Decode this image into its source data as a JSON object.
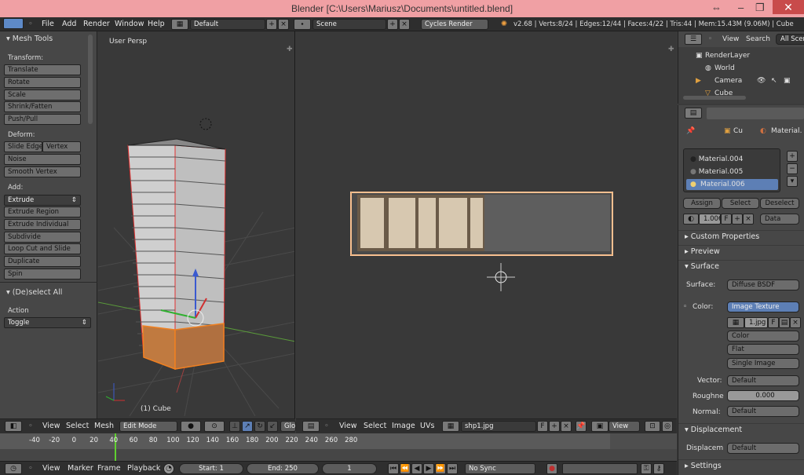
{
  "window": {
    "title": "Blender [C:\\Users\\Mariusz\\Documents\\untitled.blend]",
    "controls": [
      "⇔",
      "–",
      "❐",
      "✕"
    ]
  },
  "info_header": {
    "menus": [
      "File",
      "Add",
      "Render",
      "Window",
      "Help"
    ],
    "screen_layout": "Default",
    "scene": "Scene",
    "render_engine": "Cycles Render",
    "stats": "v2.68 | Verts:8/24 | Edges:12/44 | Faces:4/22 | Tris:44 | Mem:15.43M (9.06M) | Cube"
  },
  "tool_shelf": {
    "title": "Mesh Tools",
    "transform_label": "Transform:",
    "transform": [
      "Translate",
      "Rotate",
      "Scale",
      "Shrink/Fatten",
      "Push/Pull"
    ],
    "deform_label": "Deform:",
    "deform_row": [
      "Slide Edge",
      "Vertex"
    ],
    "deform": [
      "Noise",
      "Smooth Vertex"
    ],
    "add_label": "Add:",
    "add_dropdown": "Extrude",
    "add": [
      "Extrude Region",
      "Extrude Individual",
      "Subdivide",
      "Loop Cut and Slide",
      "Duplicate",
      "Spin"
    ],
    "operator_title": "(De)select All",
    "action_label": "Action",
    "action_value": "Toggle"
  },
  "viewport3d": {
    "view_name": "User Persp",
    "object_label": "(1) Cube"
  },
  "view3d_header": {
    "menus": [
      "View",
      "Select",
      "Mesh"
    ],
    "mode": "Edit Mode",
    "more": "Glo"
  },
  "uv_header": {
    "menus": [
      "View",
      "Select",
      "Image",
      "UVs"
    ],
    "image": "shp1.jpg",
    "fake_user": "F",
    "view_dropdown": "View"
  },
  "outliner": {
    "menus": [
      "View",
      "Search"
    ],
    "filter": "All Scen",
    "items": [
      "RenderLayer",
      "World",
      "Camera",
      "Cube"
    ]
  },
  "properties": {
    "breadcrumb": [
      "Cu",
      "Material."
    ],
    "materials": [
      "Material.004",
      "Material.005",
      "Material.006"
    ],
    "selected_material": 2,
    "assign_buttons": [
      "Assign",
      "Select",
      "Deselect"
    ],
    "slot_value": "1.006",
    "slot_f": "F",
    "data_dropdown": "Data",
    "panels": {
      "custom": "Custom Properties",
      "preview": "Preview",
      "surface": "Surface",
      "displacement": "Displacement",
      "settings": "Settings"
    },
    "surface_label": "Surface:",
    "surface_value": "Diffuse BSDF",
    "color_label": "Color:",
    "color_value": "Image Texture",
    "image_name": "1.jpg",
    "image_f": "F",
    "color_space": "Color",
    "projection": "Flat",
    "source": "Single Image",
    "vector_label": "Vector:",
    "vector_value": "Default",
    "roughness_label": "Roughne",
    "roughness_value": "0.000",
    "normal_label": "Normal:",
    "normal_value": "Default",
    "displacement_label": "Displacem",
    "displacement_value": "Default"
  },
  "timeline": {
    "ticks": [
      "-40",
      "-20",
      "0",
      "20",
      "40",
      "60",
      "80",
      "100",
      "120",
      "140",
      "160",
      "180",
      "200",
      "220",
      "240",
      "260",
      "280"
    ],
    "current_frame": 1
  },
  "timeline_header": {
    "menus": [
      "View",
      "Marker",
      "Frame",
      "Playback"
    ],
    "start_label": "Start: 1",
    "end_label": "End: 250",
    "frame": "1",
    "sync": "No Sync"
  }
}
